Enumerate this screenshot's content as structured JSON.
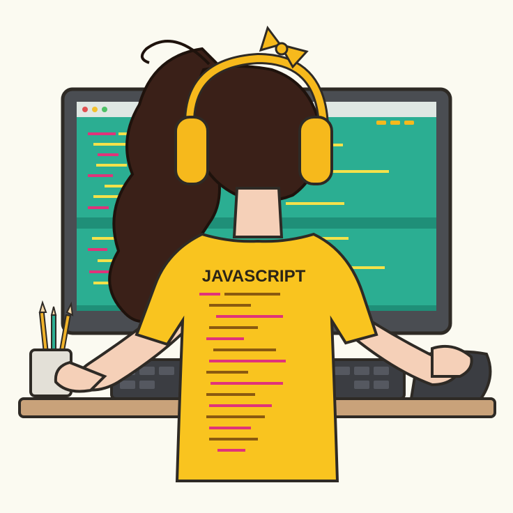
{
  "illustration": {
    "shirt_title": "JAVASCRIPT",
    "colors": {
      "background": "#fbfaf1",
      "monitor_frame": "#4a4d52",
      "screen": "#2bae92",
      "screen_dark": "#1f8f78",
      "shirt": "#f9c41f",
      "hair": "#3a2018",
      "headphones": "#f6b91c",
      "desk": "#c9a27a",
      "keyboard": "#3b3d42",
      "code_pink": "#e0337a",
      "code_yellow": "#f4e14a",
      "code_text": "#5a3f10"
    },
    "icons": [
      "pencil-cup-icon",
      "headphones-icon",
      "hair-bow-icon",
      "monitor-icon",
      "keyboard-icon",
      "mouse-icon"
    ]
  }
}
